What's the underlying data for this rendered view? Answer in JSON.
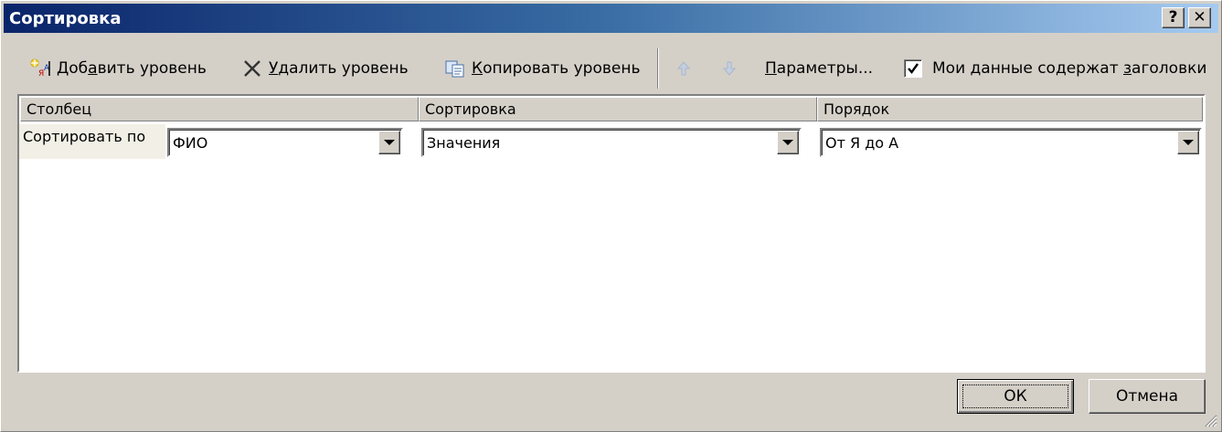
{
  "window": {
    "title": "Сортировка"
  },
  "titlebar_buttons": {
    "help": "?",
    "close": "✕"
  },
  "toolbar": {
    "add_level": {
      "pre": "Доб",
      "accel": "а",
      "post": "вить уровень"
    },
    "delete_level": {
      "pre": "",
      "accel": "У",
      "post": "далить уровень"
    },
    "copy_level": {
      "pre": "",
      "accel": "К",
      "post": "опировать уровень"
    },
    "params": {
      "pre": "",
      "accel": "П",
      "post": "араметры..."
    },
    "headers_checkbox": {
      "label_pre": "Мои данные содержат ",
      "label_accel": "з",
      "label_post": "аголовки",
      "checked": true
    }
  },
  "grid": {
    "columns": [
      "Столбец",
      "Сортировка",
      "Порядок"
    ],
    "rows": [
      {
        "label": "Сортировать по",
        "column": "ФИО",
        "sort_on": "Значения",
        "order": "От Я до А"
      }
    ]
  },
  "buttons": {
    "ok": "ОК",
    "cancel": "Отмена"
  }
}
